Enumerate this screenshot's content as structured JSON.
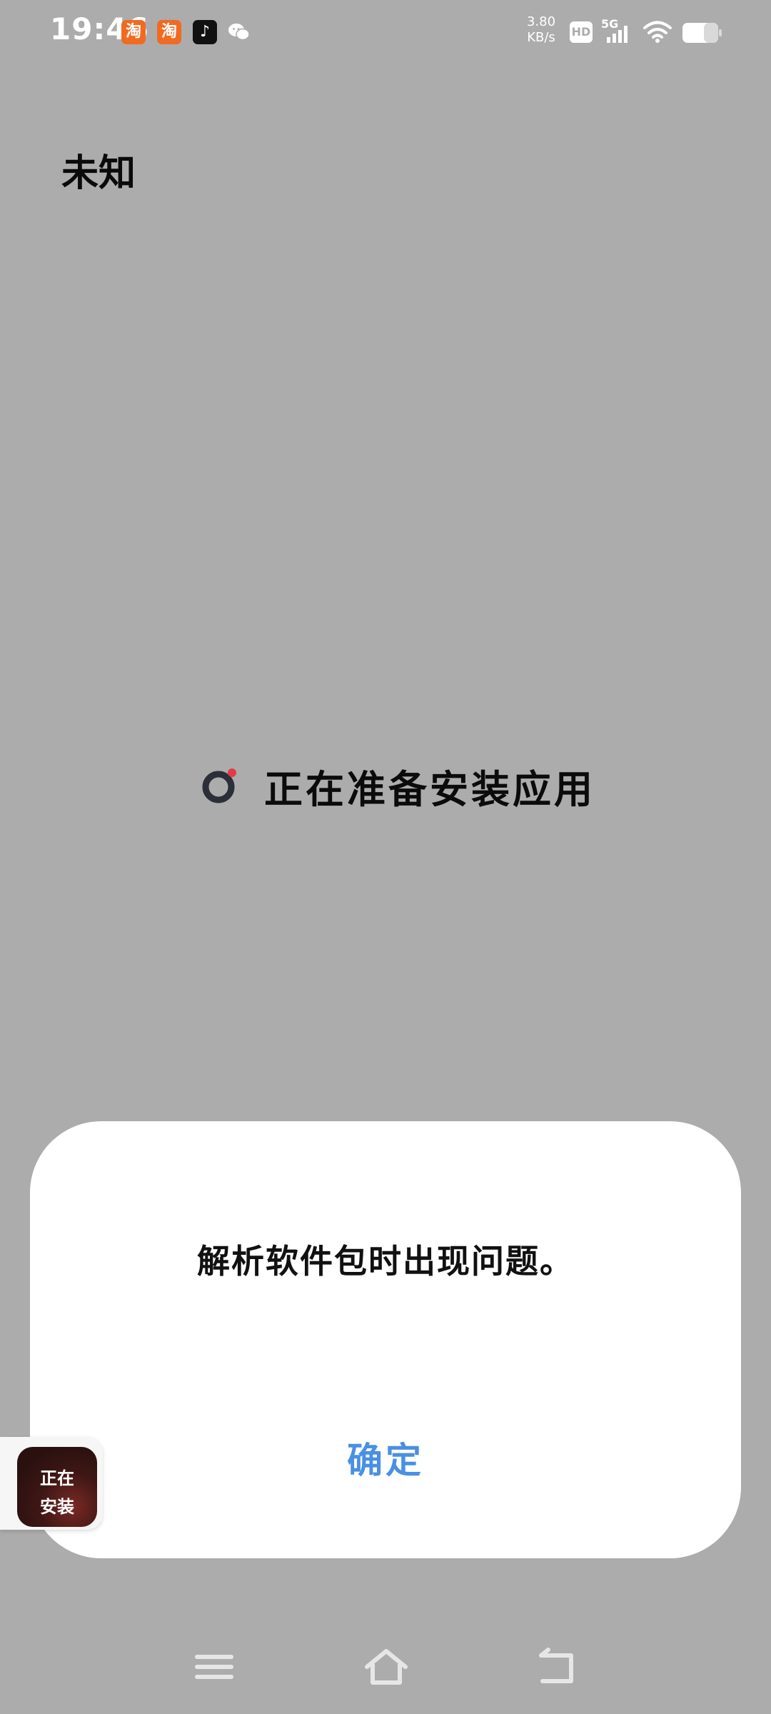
{
  "status_bar": {
    "time": "19:46",
    "net_speed_value": "3.80",
    "net_speed_unit": "KB/s",
    "hd_label": "HD",
    "network_label": "5G",
    "notifications": [
      {
        "name": "taobao-icon",
        "glyph": "淘"
      },
      {
        "name": "taobao-icon",
        "glyph": "淘"
      },
      {
        "name": "tiktok-icon",
        "glyph": "♪"
      },
      {
        "name": "wechat-icon",
        "glyph": ""
      }
    ]
  },
  "page": {
    "title": "未知"
  },
  "loading": {
    "text": "正在准备安装应用",
    "spinner_color": "#2b2f38",
    "spinner_dot_color": "#e53945"
  },
  "dialog": {
    "message": "解析软件包时出现问题。",
    "confirm_label": "确定",
    "confirm_color": "#4a90e2"
  },
  "floating_badge": {
    "line1": "正在",
    "line2": "安装"
  },
  "nav": {
    "menu_icon": "menu-icon",
    "home_icon": "home-icon",
    "back_icon": "back-icon"
  },
  "colors": {
    "background": "#acacac",
    "dialog_bg": "#ffffff"
  }
}
